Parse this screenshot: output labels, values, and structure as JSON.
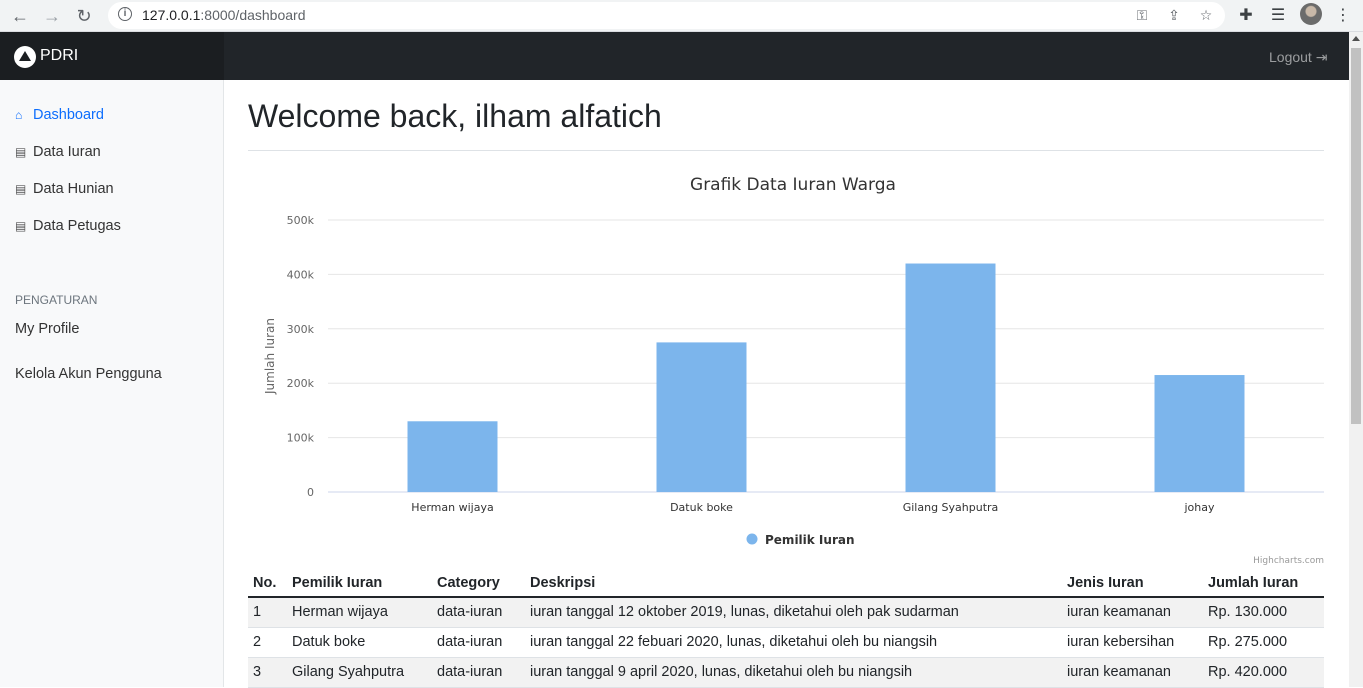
{
  "browser": {
    "url_host": "127.0.0.1",
    "url_rest": ":8000/dashboard"
  },
  "app": {
    "brand": "PDRI",
    "logout_label": "Logout"
  },
  "sidebar": {
    "items": [
      {
        "label": "Dashboard",
        "icon": "house-icon",
        "active": true
      },
      {
        "label": "Data Iuran",
        "icon": "document-icon"
      },
      {
        "label": "Data Hunian",
        "icon": "document-icon"
      },
      {
        "label": "Data Petugas",
        "icon": "document-icon"
      }
    ],
    "heading": "PENGATURAN",
    "settings": [
      {
        "label": "My Profile"
      },
      {
        "label": "Kelola Akun Pengguna"
      }
    ]
  },
  "main": {
    "title": "Welcome back, ilham alfatich"
  },
  "chart_data": {
    "type": "bar",
    "title": "Grafik Data Iuran Warga",
    "ylabel": "Jumlah Iuran",
    "xlabel": "",
    "categories": [
      "Herman wijaya",
      "Datuk boke",
      "Gilang Syahputra",
      "johay"
    ],
    "series": [
      {
        "name": "Pemilik Iuran",
        "values": [
          130000,
          275000,
          420000,
          215000
        ]
      }
    ],
    "ylim": [
      0,
      500000
    ],
    "yticks": [
      "0",
      "100k",
      "200k",
      "300k",
      "400k",
      "500k"
    ],
    "color": "#7cb5ec",
    "legend": "bottom-center",
    "grid": true,
    "credits": "Highcharts.com"
  },
  "table": {
    "headers": [
      "No.",
      "Pemilik Iuran",
      "Category",
      "Deskripsi",
      "Jenis Iuran",
      "Jumlah Iuran"
    ],
    "rows": [
      [
        "1",
        "Herman wijaya",
        "data-iuran",
        "iuran tanggal 12 oktober 2019, lunas, diketahui oleh pak sudarman",
        "iuran keamanan",
        "Rp. 130.000"
      ],
      [
        "2",
        "Datuk boke",
        "data-iuran",
        "iuran tanggal 22 febuari 2020, lunas, diketahui oleh bu niangsih",
        "iuran kebersihan",
        "Rp. 275.000"
      ],
      [
        "3",
        "Gilang Syahputra",
        "data-iuran",
        "iuran tanggal 9 april 2020, lunas, diketahui oleh bu niangsih",
        "iuran keamanan",
        "Rp. 420.000"
      ]
    ]
  }
}
